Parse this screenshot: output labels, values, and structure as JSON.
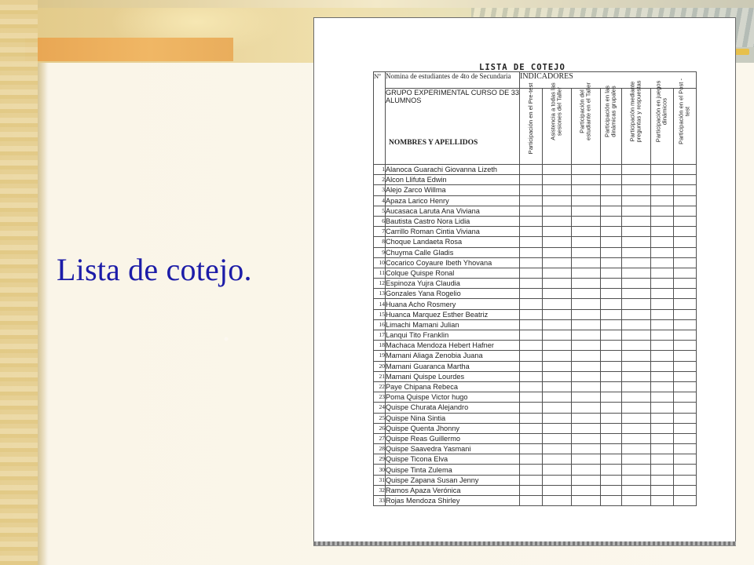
{
  "slide": {
    "title": "Lista de cotejo."
  },
  "document": {
    "title": "LISTA DE COTEJO",
    "header": {
      "num": "Nº",
      "nomina": "Nomina de estudiantes de 4to de Secundaria",
      "grupo": "GRUPO EXPERIMENTAL CURSO DE 33 ALUMNOS",
      "nombres": "NOMBRES Y APELLIDOS",
      "indicadores": "INDICADORES"
    },
    "indicators": [
      "Participación en el Pre-test",
      "Asistencia a todas las sesiones del Taller",
      "Participación del estudiante en el Taller",
      "Participación en las dinámicas grupales",
      "Participación mediante preguntas y respuestas",
      "Participación en juegos dinámicos",
      "Participación en el Post -test"
    ],
    "students": [
      {
        "n": "1",
        "name": "Alanoca Guarachi Giovanna Lizeth"
      },
      {
        "n": "2",
        "name": "Alcon Llifuta Edwin"
      },
      {
        "n": "3",
        "name": "Alejo Zarco Willma"
      },
      {
        "n": "4",
        "name": "Apaza Larico Henry"
      },
      {
        "n": "5",
        "name": "Aucasaca Laruta  Ana Viviana"
      },
      {
        "n": "6",
        "name": "Bautista Castro Nora Lidia"
      },
      {
        "n": "7",
        "name": "Carrillo Roman Cintia Viviana"
      },
      {
        "n": "8",
        "name": "Choque Landaeta Rosa"
      },
      {
        "n": "9",
        "name": "Chuyma Calle Gladis"
      },
      {
        "n": "10",
        "name": "Cocarico Coyaure Ibeth Yhovana"
      },
      {
        "n": "11",
        "name": "Colque Quispe Ronal"
      },
      {
        "n": "12",
        "name": "Espinoza Yujra Claudia"
      },
      {
        "n": "13",
        "name": "Gonzales Yana Rogelio"
      },
      {
        "n": "14",
        "name": "Huana Acho Rosmery"
      },
      {
        "n": "15",
        "name": "Huanca Marquez Esther Beatriz"
      },
      {
        "n": "16",
        "name": "Limachi Mamani Julian"
      },
      {
        "n": "17",
        "name": "Lanqui Tito Franklin"
      },
      {
        "n": "18",
        "name": "Machaca Mendoza Hebert Hafner"
      },
      {
        "n": "19",
        "name": "Mamani Aliaga Zenobia Juana"
      },
      {
        "n": "20",
        "name": "Mamani Guaranca Martha"
      },
      {
        "n": "21",
        "name": "Mamani Quispe Lourdes"
      },
      {
        "n": "22",
        "name": "Paye Chipana Rebeca"
      },
      {
        "n": "23",
        "name": "Poma Quispe Victor hugo"
      },
      {
        "n": "24",
        "name": "Quispe Churata Alejandro"
      },
      {
        "n": "25",
        "name": "Quispe Nina Sintia"
      },
      {
        "n": "26",
        "name": "Quispe Quenta Jhonny"
      },
      {
        "n": "27",
        "name": "Quispe Reas Guillermo"
      },
      {
        "n": "28",
        "name": "Quispe Saavedra Yasmani"
      },
      {
        "n": "29",
        "name": "Quispe Ticona Elva"
      },
      {
        "n": "30",
        "name": "Quispe Tinta Zulema"
      },
      {
        "n": "31",
        "name": "Quispe Zapana Susan Jenny"
      },
      {
        "n": "32",
        "name": "Ramos Apaza Verónica"
      },
      {
        "n": "33",
        "name": "Rojas Mendoza Shirley"
      }
    ]
  },
  "colors": {
    "title": "#1c1ca8",
    "accent_bar": "#e8a552",
    "background": "#f7eed6"
  }
}
